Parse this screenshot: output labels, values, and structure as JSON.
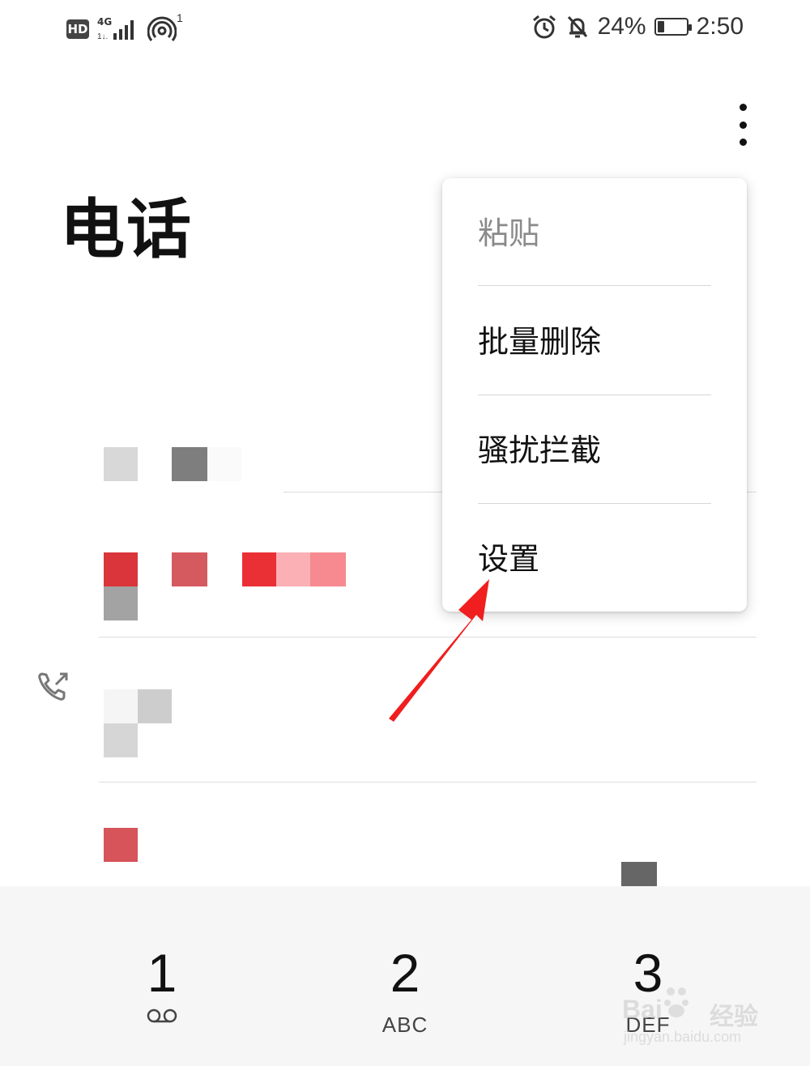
{
  "status_bar": {
    "hd_label": "HD",
    "network_label": "4G",
    "hotspot_count": "1",
    "battery_percent": "24%",
    "battery_level": 0.24,
    "time": "2:50",
    "icons": [
      "signal-icon",
      "hotspot-icon",
      "alarm-icon",
      "mute-icon",
      "battery-icon"
    ]
  },
  "header": {
    "title": "电话",
    "more_icon": "more-vertical-icon"
  },
  "menu": {
    "items": [
      {
        "label": "粘贴",
        "enabled": false
      },
      {
        "label": "批量删除",
        "enabled": true
      },
      {
        "label": "骚扰拦截",
        "enabled": true
      },
      {
        "label": "设置",
        "enabled": true
      }
    ]
  },
  "annotation": {
    "arrow_color": "#f01e1e",
    "target": "设置"
  },
  "dialpad": {
    "keys": [
      {
        "digit": "1",
        "sub": "voicemail-icon"
      },
      {
        "digit": "2",
        "sub": "ABC"
      },
      {
        "digit": "3",
        "sub": "DEF"
      }
    ]
  },
  "watermark": {
    "text": "经验",
    "brand": "Bai",
    "url": "jingyan.baidu.com"
  },
  "colors": {
    "accent_red": "#f01e1e",
    "dialpad_bg": "#f6f6f6"
  }
}
